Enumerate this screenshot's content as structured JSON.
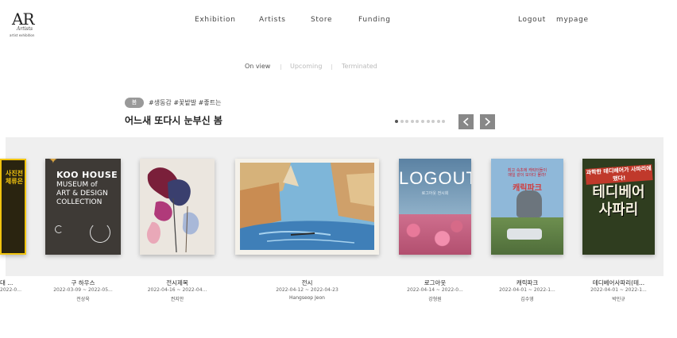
{
  "header": {
    "logo": {
      "mark": "AR",
      "script": "Artists",
      "tagline": "artist exhibition"
    },
    "nav": [
      {
        "label": "Exhibition"
      },
      {
        "label": "Artists"
      },
      {
        "label": "Store"
      },
      {
        "label": "Funding"
      }
    ],
    "account": {
      "logout": "Logout",
      "mypage": "mypage"
    }
  },
  "filters": {
    "tabs": [
      {
        "label": "On view",
        "active": true
      },
      {
        "label": "Upcoming",
        "active": false
      },
      {
        "label": "Terminated",
        "active": false
      }
    ]
  },
  "season": {
    "badge": "봄",
    "hashtags": "#생동감 #꽃밭발 #좋트는",
    "title": "어느새 또다시 눈부신 봄",
    "pagination": {
      "total": 10,
      "active_index": 0
    }
  },
  "carousel": {
    "items": [
      {
        "title": "대 ...",
        "date": "2022-0...",
        "artist": "",
        "poster": {
          "text": "사진전\n체류은"
        }
      },
      {
        "title": "구 하우스",
        "date": "2022-03-09 ~ 2022-05...",
        "artist": "전상욱",
        "poster": {
          "title": "KOO HOUSE",
          "subtitle": "MUSEUM of\nART & DESIGN\nCOLLECTION"
        }
      },
      {
        "title": "전시제목",
        "date": "2022-04-16 ~ 2022-04...",
        "artist": "권지안",
        "poster": {}
      },
      {
        "title": "전시",
        "date": "2022-04-12 ~ 2022-04-23",
        "artist": "Hangseop Jeon",
        "poster": {}
      },
      {
        "title": "로그아웃",
        "date": "2022-04-14 ~ 2022-0...",
        "artist": "강형원",
        "poster": {
          "title": "LOGOUT",
          "subtitle": "로그아웃 전시회"
        }
      },
      {
        "title": "캐릭파크",
        "date": "2022-04-01 ~ 2022-1...",
        "artist": "김수영",
        "poster": {
          "caption": "최고 속초에 캐릭터들이\n매일 같이 모이다 몰라!",
          "title": "캐릭파크"
        }
      },
      {
        "title": "테디베어사파리(테...",
        "date": "2022-04-01 ~ 2022-1...",
        "artist": "박민규",
        "poster": {
          "caption": "과학한 테디베어가 사파리에 떴다!",
          "title": "테디베어\n사파리"
        }
      }
    ]
  },
  "colors": {
    "band": "#efefef",
    "arrow_bg": "#888888",
    "badge_bg": "#999999",
    "dot_active": "#555555",
    "dot_inactive": "#cccccc"
  },
  "icons": {
    "prev": "chevron-left-icon",
    "next": "chevron-right-icon"
  }
}
